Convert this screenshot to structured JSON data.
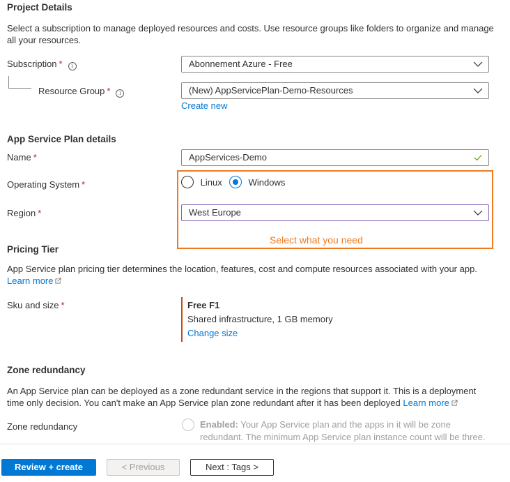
{
  "project_details": {
    "title": "Project Details",
    "description": "Select a subscription to manage deployed resources and costs. Use resource groups like folders to organize and manage all your resources.",
    "subscription": {
      "label": "Subscription",
      "required_mark": "*",
      "value": "Abonnement Azure - Free"
    },
    "resource_group": {
      "label": "Resource Group",
      "required_mark": "*",
      "value": "(New) AppServicePlan-Demo-Resources",
      "create_new_label": "Create new"
    }
  },
  "plan_details": {
    "title": "App Service Plan details",
    "name": {
      "label": "Name",
      "required_mark": "*",
      "value": "AppServices-Demo",
      "valid": true
    },
    "operating_system": {
      "label": "Operating System",
      "required_mark": "*",
      "options": [
        {
          "label": "Linux",
          "selected": false
        },
        {
          "label": "Windows",
          "selected": true
        }
      ]
    },
    "region": {
      "label": "Region",
      "required_mark": "*",
      "value": "West Europe"
    }
  },
  "annotation": {
    "text": "Select what you need",
    "color": "#f07a1e"
  },
  "pricing_tier": {
    "title": "Pricing Tier",
    "description": "App Service plan pricing tier determines the location, features, cost and compute resources associated with your app.",
    "learn_more_label": "Learn more",
    "sku": {
      "label": "Sku and size",
      "required_mark": "*",
      "name": "Free F1",
      "details": "Shared infrastructure, 1 GB memory",
      "change_label": "Change size"
    }
  },
  "zone_redundancy": {
    "title": "Zone redundancy",
    "description": "An App Service plan can be deployed as a zone redundant service in the regions that support it. This is a deployment time only decision. You can't make an App Service plan zone redundant after it has been deployed",
    "learn_more_label": "Learn more",
    "field_label": "Zone redundancy",
    "option_bold": "Enabled:",
    "option_text": "Your App Service plan and the apps in it will be zone redundant. The minimum App Service plan instance count will be three."
  },
  "footer": {
    "review_create_label": "Review + create",
    "previous_label": "< Previous",
    "next_label": "Next : Tags >"
  },
  "colors": {
    "accent": "#0078d4",
    "required": "#a4262c",
    "valid": "#57a300",
    "sku_bar": "#c4500c"
  }
}
